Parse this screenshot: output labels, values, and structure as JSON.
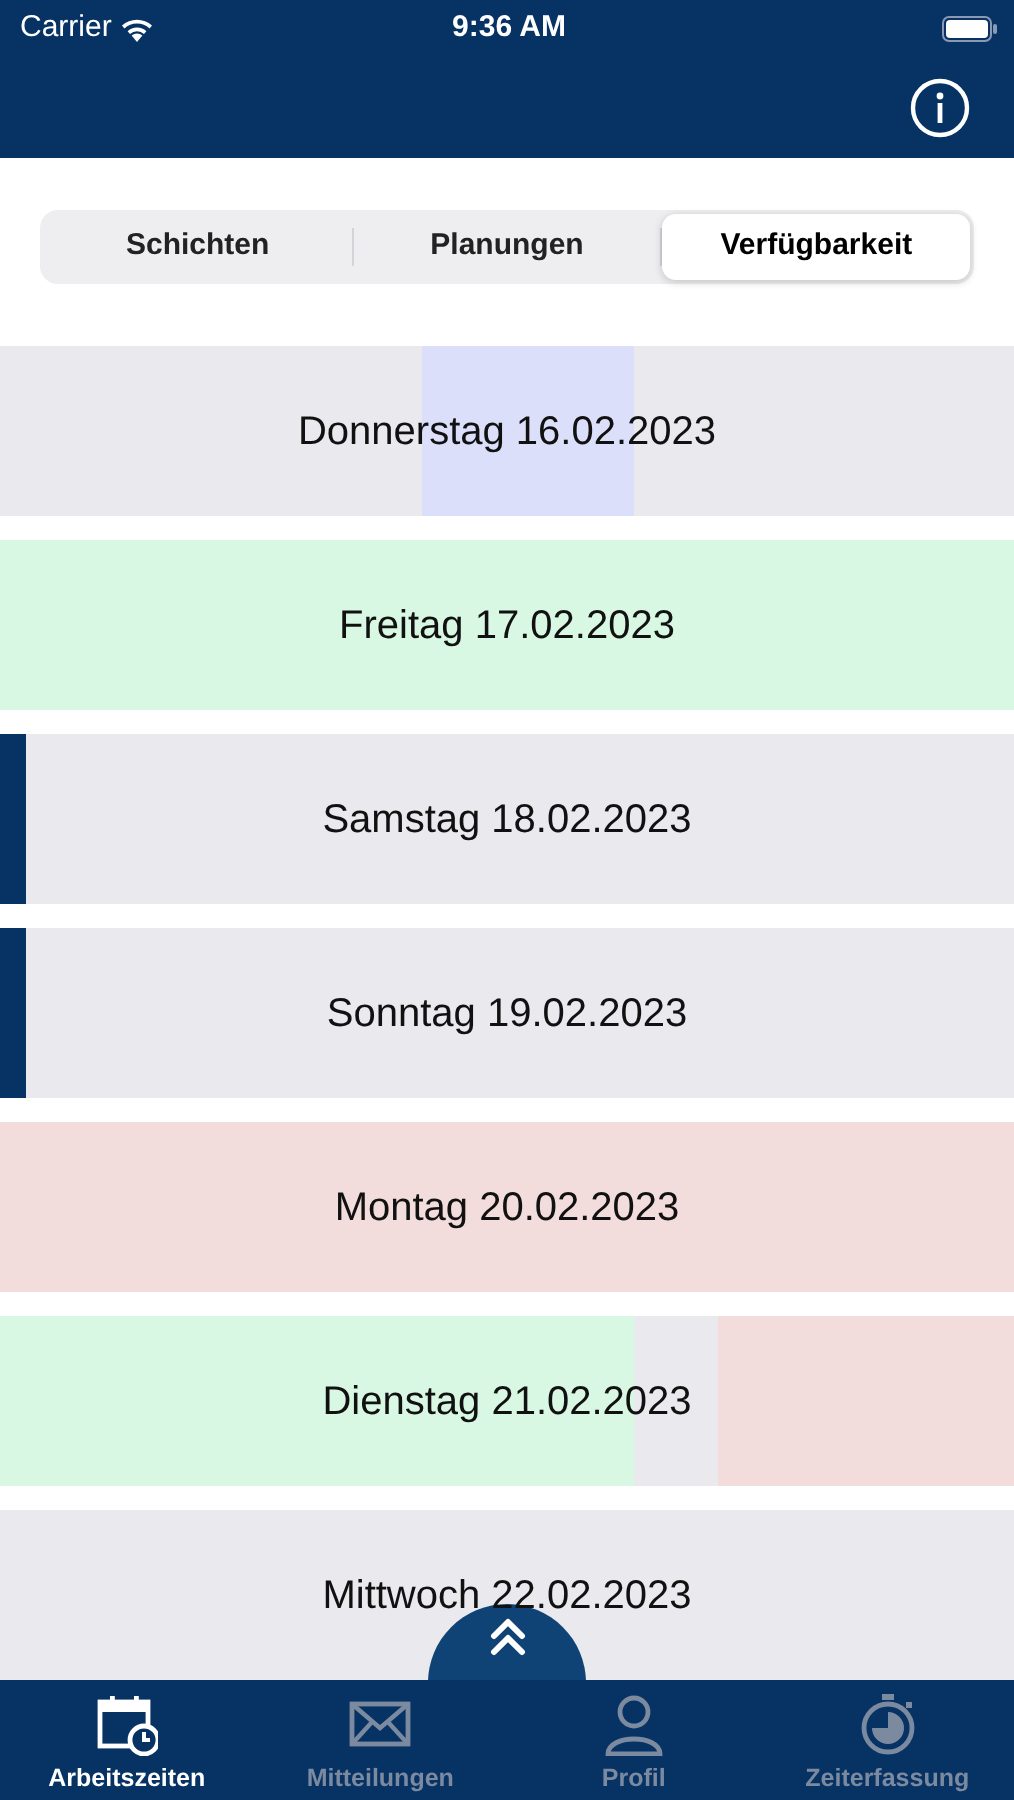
{
  "status_bar": {
    "carrier": "Carrier",
    "time": "9:36 AM"
  },
  "segments": [
    {
      "label": "Schichten",
      "selected": false
    },
    {
      "label": "Planungen",
      "selected": false
    },
    {
      "label": "Verfügbarkeit",
      "selected": true
    }
  ],
  "days": [
    {
      "label": "Donnerstag 16.02.2023",
      "marked": false,
      "hours": [
        {
          "color": "#e9e9ee"
        },
        {
          "color": "#e9e9ee"
        },
        {
          "color": "#e9e9ee"
        },
        {
          "color": "#e9e9ee"
        },
        {
          "color": "#e9e9ee"
        },
        {
          "color": "#e9e9ee"
        },
        {
          "color": "#e9e9ee"
        },
        {
          "color": "#e9e9ee"
        },
        {
          "color": "#e9e9ee"
        },
        {
          "color": "#e9e9ee"
        },
        {
          "color": "#dcdffa"
        },
        {
          "color": "#dcdffa"
        },
        {
          "color": "#dcdffa"
        },
        {
          "color": "#dcdffa"
        },
        {
          "color": "#dcdffa"
        },
        {
          "color": "#e9e9ee"
        },
        {
          "color": "#e9e9ee"
        },
        {
          "color": "#e9e9ee"
        },
        {
          "color": "#e9e9ee"
        },
        {
          "color": "#e9e9ee"
        },
        {
          "color": "#e9e9ee"
        },
        {
          "color": "#e9e9ee"
        },
        {
          "color": "#e9e9ee"
        },
        {
          "color": "#e9e9ee"
        }
      ]
    },
    {
      "label": "Freitag 17.02.2023",
      "marked": false,
      "hours": [
        {
          "color": "#d9f8e4"
        },
        {
          "color": "#d9f8e4"
        },
        {
          "color": "#d9f8e4"
        },
        {
          "color": "#d9f8e4"
        },
        {
          "color": "#d9f8e4"
        },
        {
          "color": "#d9f8e4"
        },
        {
          "color": "#d9f8e4"
        },
        {
          "color": "#d9f8e4"
        },
        {
          "color": "#d9f8e4"
        },
        {
          "color": "#d9f8e4"
        },
        {
          "color": "#d9f8e4"
        },
        {
          "color": "#d9f8e4"
        },
        {
          "color": "#d9f8e4"
        },
        {
          "color": "#d9f8e4"
        },
        {
          "color": "#d9f8e4"
        },
        {
          "color": "#d9f8e4"
        },
        {
          "color": "#d9f8e4"
        },
        {
          "color": "#d9f8e4"
        },
        {
          "color": "#d9f8e4"
        },
        {
          "color": "#d9f8e4"
        },
        {
          "color": "#d9f8e4"
        },
        {
          "color": "#d9f8e4"
        },
        {
          "color": "#d9f8e4"
        },
        {
          "color": "#d9f8e4"
        }
      ]
    },
    {
      "label": "Samstag 18.02.2023",
      "marked": true,
      "hours": [
        {
          "color": "#e9e9ee"
        },
        {
          "color": "#e9e9ee"
        },
        {
          "color": "#e9e9ee"
        },
        {
          "color": "#e9e9ee"
        },
        {
          "color": "#e9e9ee"
        },
        {
          "color": "#e9e9ee"
        },
        {
          "color": "#e9e9ee"
        },
        {
          "color": "#e9e9ee"
        },
        {
          "color": "#e9e9ee"
        },
        {
          "color": "#e9e9ee"
        },
        {
          "color": "#e9e9ee"
        },
        {
          "color": "#e9e9ee"
        },
        {
          "color": "#e9e9ee"
        },
        {
          "color": "#e9e9ee"
        },
        {
          "color": "#e9e9ee"
        },
        {
          "color": "#e9e9ee"
        },
        {
          "color": "#e9e9ee"
        },
        {
          "color": "#e9e9ee"
        },
        {
          "color": "#e9e9ee"
        },
        {
          "color": "#e9e9ee"
        },
        {
          "color": "#e9e9ee"
        },
        {
          "color": "#e9e9ee"
        },
        {
          "color": "#e9e9ee"
        },
        {
          "color": "#e9e9ee"
        }
      ]
    },
    {
      "label": "Sonntag 19.02.2023",
      "marked": true,
      "hours": [
        {
          "color": "#e9e9ee"
        },
        {
          "color": "#e9e9ee"
        },
        {
          "color": "#e9e9ee"
        },
        {
          "color": "#e9e9ee"
        },
        {
          "color": "#e9e9ee"
        },
        {
          "color": "#e9e9ee"
        },
        {
          "color": "#e9e9ee"
        },
        {
          "color": "#e9e9ee"
        },
        {
          "color": "#e9e9ee"
        },
        {
          "color": "#e9e9ee"
        },
        {
          "color": "#e9e9ee"
        },
        {
          "color": "#e9e9ee"
        },
        {
          "color": "#e9e9ee"
        },
        {
          "color": "#e9e9ee"
        },
        {
          "color": "#e9e9ee"
        },
        {
          "color": "#e9e9ee"
        },
        {
          "color": "#e9e9ee"
        },
        {
          "color": "#e9e9ee"
        },
        {
          "color": "#e9e9ee"
        },
        {
          "color": "#e9e9ee"
        },
        {
          "color": "#e9e9ee"
        },
        {
          "color": "#e9e9ee"
        },
        {
          "color": "#e9e9ee"
        },
        {
          "color": "#e9e9ee"
        }
      ]
    },
    {
      "label": "Montag 20.02.2023",
      "marked": false,
      "hours": [
        {
          "color": "#f3dcdc"
        },
        {
          "color": "#f3dcdc"
        },
        {
          "color": "#f3dcdc"
        },
        {
          "color": "#f3dcdc"
        },
        {
          "color": "#f3dcdc"
        },
        {
          "color": "#f3dcdc"
        },
        {
          "color": "#f3dcdc"
        },
        {
          "color": "#f3dcdc"
        },
        {
          "color": "#f3dcdc"
        },
        {
          "color": "#f3dcdc"
        },
        {
          "color": "#f3dcdc"
        },
        {
          "color": "#f3dcdc"
        },
        {
          "color": "#f3dcdc"
        },
        {
          "color": "#f3dcdc"
        },
        {
          "color": "#f3dcdc"
        },
        {
          "color": "#f3dcdc"
        },
        {
          "color": "#f3dcdc"
        },
        {
          "color": "#f3dcdc"
        },
        {
          "color": "#f3dcdc"
        },
        {
          "color": "#f3dcdc"
        },
        {
          "color": "#f3dcdc"
        },
        {
          "color": "#f3dcdc"
        },
        {
          "color": "#f3dcdc"
        },
        {
          "color": "#f3dcdc"
        }
      ]
    },
    {
      "label": "Dienstag 21.02.2023",
      "marked": false,
      "hours": [
        {
          "color": "#d9f8e4"
        },
        {
          "color": "#d9f8e4"
        },
        {
          "color": "#d9f8e4"
        },
        {
          "color": "#d9f8e4"
        },
        {
          "color": "#d9f8e4"
        },
        {
          "color": "#d9f8e4"
        },
        {
          "color": "#d9f8e4"
        },
        {
          "color": "#d9f8e4"
        },
        {
          "color": "#d9f8e4"
        },
        {
          "color": "#d9f8e4"
        },
        {
          "color": "#d9f8e4"
        },
        {
          "color": "#d9f8e4"
        },
        {
          "color": "#d9f8e4"
        },
        {
          "color": "#d9f8e4"
        },
        {
          "color": "#d9f8e4"
        },
        {
          "color": "#e9e9ee"
        },
        {
          "color": "#e9e9ee"
        },
        {
          "color": "#f3dcdc"
        },
        {
          "color": "#f3dcdc"
        },
        {
          "color": "#f3dcdc"
        },
        {
          "color": "#f3dcdc"
        },
        {
          "color": "#f3dcdc"
        },
        {
          "color": "#f3dcdc"
        },
        {
          "color": "#f3dcdc"
        }
      ]
    },
    {
      "label": "Mittwoch 22.02.2023",
      "marked": false,
      "hours": [
        {
          "color": "#e9e9ee"
        },
        {
          "color": "#e9e9ee"
        },
        {
          "color": "#e9e9ee"
        },
        {
          "color": "#e9e9ee"
        },
        {
          "color": "#e9e9ee"
        },
        {
          "color": "#e9e9ee"
        },
        {
          "color": "#e9e9ee"
        },
        {
          "color": "#e9e9ee"
        },
        {
          "color": "#e9e9ee"
        },
        {
          "color": "#e9e9ee"
        },
        {
          "color": "#e9e9ee"
        },
        {
          "color": "#e9e9ee"
        },
        {
          "color": "#e9e9ee"
        },
        {
          "color": "#e9e9ee"
        },
        {
          "color": "#e9e9ee"
        },
        {
          "color": "#e9e9ee"
        },
        {
          "color": "#e9e9ee"
        },
        {
          "color": "#e9e9ee"
        },
        {
          "color": "#e9e9ee"
        },
        {
          "color": "#e9e9ee"
        },
        {
          "color": "#e9e9ee"
        },
        {
          "color": "#e9e9ee"
        },
        {
          "color": "#e9e9ee"
        },
        {
          "color": "#e9e9ee"
        }
      ]
    }
  ],
  "tab_bar": [
    {
      "label": "Arbeitszeiten",
      "kind": "calendar",
      "selected": true
    },
    {
      "label": "Mitteilungen",
      "kind": "mail",
      "selected": false
    },
    {
      "label": "Profil",
      "kind": "person",
      "selected": false
    },
    {
      "label": "Zeiterfassung",
      "kind": "stopwatch",
      "selected": false
    }
  ]
}
